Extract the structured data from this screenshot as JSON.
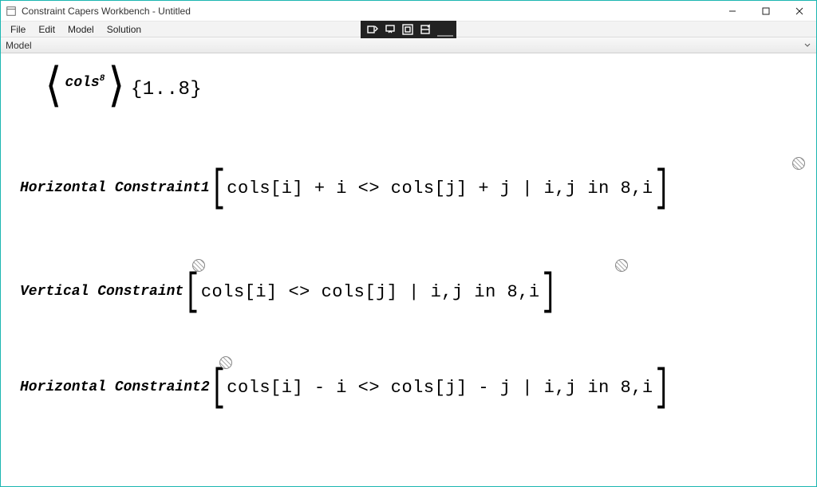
{
  "window": {
    "title": "Constraint Capers Workbench - Untitled"
  },
  "menu": {
    "file": "File",
    "edit": "Edit",
    "model": "Model",
    "solution": "Solution"
  },
  "subbar": {
    "label": "Model"
  },
  "variable": {
    "name": "cols",
    "superscript": "8",
    "domain": "{1..8}"
  },
  "constraints": [
    {
      "label": "Horizontal Constraint1",
      "expr": "cols[i] + i <> cols[j] + j | i,j in 8,i"
    },
    {
      "label": "Vertical Constraint",
      "expr": "cols[i] <> cols[j] | i,j in 8,i"
    },
    {
      "label": "Horizontal Constraint2",
      "expr": "cols[i] - i <> cols[j] - j | i,j in 8,i"
    }
  ],
  "overlay_tools": [
    "tool-a",
    "tool-b",
    "tool-c",
    "tool-d"
  ]
}
